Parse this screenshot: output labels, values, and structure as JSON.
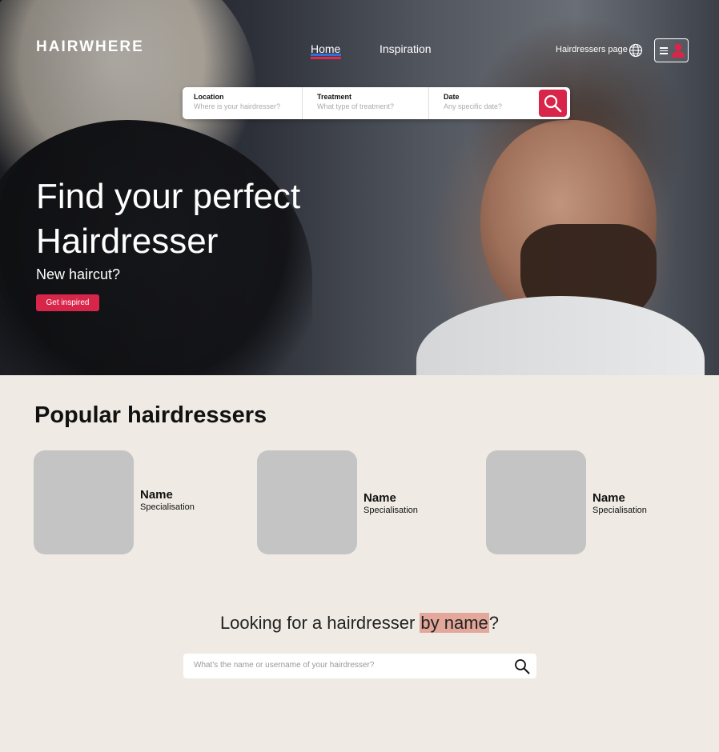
{
  "header": {
    "logo": "HAIRWHERE",
    "nav": [
      "Home",
      "Inspiration"
    ],
    "hairdressers_page": "Hairdressers page"
  },
  "search": {
    "location_label": "Location",
    "location_placeholder": "Where is your hairdresser?",
    "treatment_label": "Treatment",
    "treatment_placeholder": "What type of treatment?",
    "date_label": "Date",
    "date_placeholder": "Any specific date?"
  },
  "hero": {
    "title_line1": "Find your perfect",
    "title_line2": "Hairdresser",
    "subtitle": "New haircut?",
    "cta": "Get inspired"
  },
  "popular": {
    "title": "Popular hairdressers",
    "cards": [
      {
        "name": "Name",
        "specialisation": "Specialisation"
      },
      {
        "name": "Name",
        "specialisation": "Specialisation"
      },
      {
        "name": "Name",
        "specialisation": "Specialisation"
      }
    ]
  },
  "byname": {
    "prefix": "Looking for a hairdresser ",
    "highlight": "by name",
    "suffix": "?",
    "placeholder": "What's the name or username of your hairdresser?"
  },
  "colors": {
    "accent": "#d8264b",
    "nav_underline_blue": "#2f6fd6",
    "background": "#efebe4",
    "highlight": "#e3a89b"
  },
  "icons": [
    "globe-icon",
    "menu-icon",
    "user-icon",
    "search-icon"
  ]
}
